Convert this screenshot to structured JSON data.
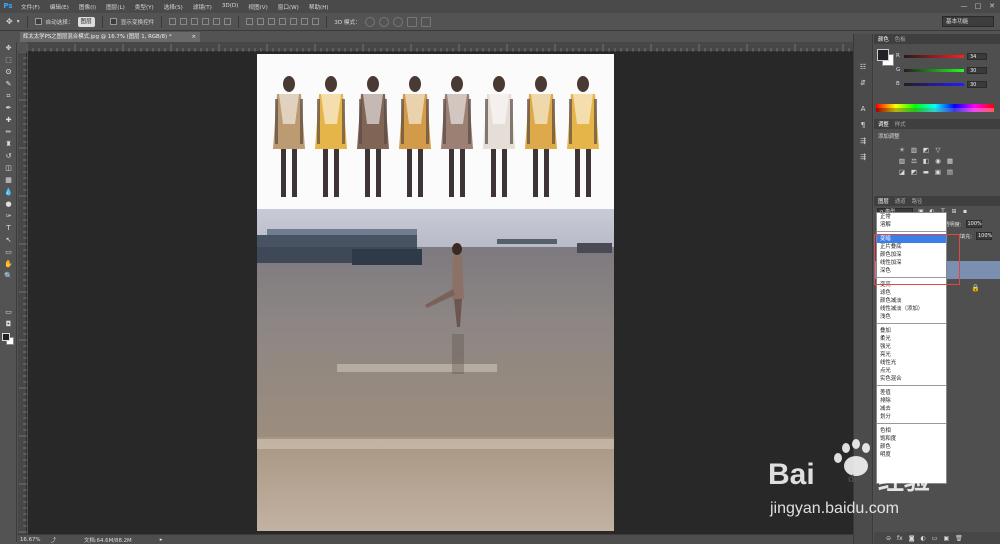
{
  "app": {
    "logo": "Ps",
    "menus": [
      "文件(F)",
      "编辑(E)",
      "图像(I)",
      "图层(L)",
      "类型(Y)",
      "选择(S)",
      "滤镜(T)",
      "3D(D)",
      "视图(V)",
      "窗口(W)",
      "帮助(H)"
    ],
    "window_controls": [
      "—",
      "□",
      "✕"
    ]
  },
  "options_bar": {
    "auto_select_label": "自动选择：",
    "auto_select_value": "图层",
    "show_transform_label": "显示变换控件",
    "mode_3d_label": "3D 模式：",
    "workspace": "基本功能"
  },
  "document_tab": {
    "title": "辉太太学PS之图层混合模式.jpg @ 16.7% (图层 1, RGB/8) *",
    "close": "×"
  },
  "toolbox": {
    "tools": [
      "move-tool",
      "marquee-tool",
      "lasso-tool",
      "quick-select-tool",
      "crop-tool",
      "eyedropper-tool",
      "healing-tool",
      "brush-tool",
      "clone-stamp-tool",
      "history-brush-tool",
      "eraser-tool",
      "gradient-tool",
      "blur-tool",
      "dodge-tool",
      "pen-tool",
      "type-tool",
      "path-select-tool",
      "shape-tool",
      "hand-tool",
      "zoom-tool"
    ],
    "glyphs": [
      "✥",
      "⬚",
      "ʘ",
      "✎",
      "⌗",
      "✒",
      "✚",
      "✏",
      "♜",
      "↺",
      "◫",
      "▦",
      "💧",
      "●",
      "✑",
      "T",
      "↖",
      "▭",
      "✋",
      "🔍"
    ]
  },
  "status_bar": {
    "zoom": "16.67%",
    "doc_size": "文档:64.6M/88.2M"
  },
  "color_panel": {
    "tabs": [
      "颜色",
      "色板"
    ],
    "r": {
      "label": "R",
      "value": "34"
    },
    "g": {
      "label": "G",
      "value": "30"
    },
    "b": {
      "label": "B",
      "value": "30"
    }
  },
  "adjustments_panel": {
    "tabs": [
      "调整",
      "样式"
    ],
    "title": "添加调整",
    "row1": [
      "☀",
      "▥",
      "◩",
      "▽"
    ],
    "row2": [
      "▨",
      "⚖",
      "◧",
      "◉",
      "▦"
    ],
    "row3": [
      "◪",
      "◩",
      "▬",
      "▣",
      "▤"
    ]
  },
  "layers_panel": {
    "tabs": [
      "图层",
      "通道",
      "路径"
    ],
    "kind_label": "ρ 类型",
    "filter_icons": [
      "▣",
      "◐",
      "T",
      "⊞",
      "▪"
    ],
    "blend_mode_value": "正常",
    "opacity_label": "不透明度:",
    "opacity_value": "100%",
    "fill_label": "填充:",
    "fill_value": "100%",
    "bottom_icons": [
      "⊝",
      "fx",
      "◙",
      "◐",
      "▭",
      "▣",
      "🗑"
    ]
  },
  "blend_dropdown": {
    "groups": [
      [
        "正常",
        "溶解"
      ],
      [
        "变暗",
        "正片叠底",
        "颜色加深",
        "线性加深",
        "深色"
      ],
      [
        "变亮",
        "滤色",
        "颜色减淡",
        "线性减淡（添加）",
        "浅色"
      ],
      [
        "叠加",
        "柔光",
        "强光",
        "亮光",
        "线性光",
        "点光",
        "实色混合"
      ],
      [
        "差值",
        "排除",
        "减去",
        "划分"
      ],
      [
        "色相",
        "饱和度",
        "颜色",
        "明度"
      ]
    ],
    "highlighted": "变暗"
  },
  "watermark": {
    "brand": "Bai",
    "paw": "du",
    "cn": "经验",
    "url": "jingyan.baidu.com"
  }
}
